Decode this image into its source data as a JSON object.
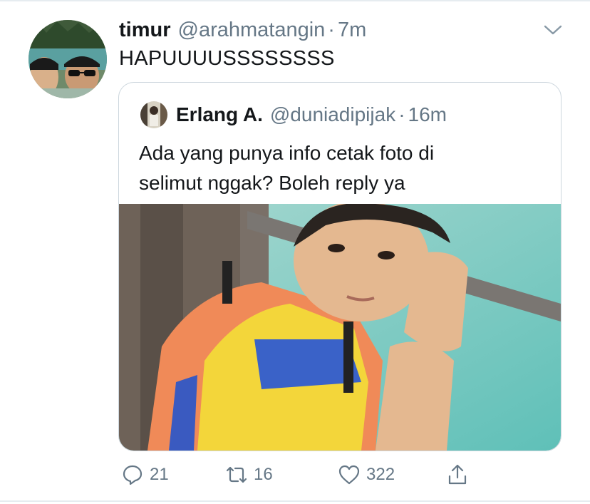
{
  "tweet": {
    "display_name": "timur",
    "handle": "@arahmatangin",
    "separator": "·",
    "time": "7m",
    "text": "HAPUUUUSSSSSSSS",
    "avatar_icon": "profile-photo-icon",
    "menu_icon": "chevron-down-icon"
  },
  "quoted": {
    "display_name": "Erlang A.",
    "handle": "@duniadipijak",
    "separator": "·",
    "time": "16m",
    "text_line1": "Ada yang punya info cetak foto di",
    "text_line2": "selimut nggak? Boleh reply ya",
    "media_icon": "photo-of-boy-icon"
  },
  "actions": {
    "reply_count": "21",
    "retweet_count": "16",
    "like_count": "322",
    "reply_icon": "reply-icon",
    "retweet_icon": "retweet-icon",
    "like_icon": "heart-icon",
    "share_icon": "share-icon"
  },
  "colors": {
    "text_primary": "#14171a",
    "text_secondary": "#657786",
    "border": "#ccd6dd"
  }
}
